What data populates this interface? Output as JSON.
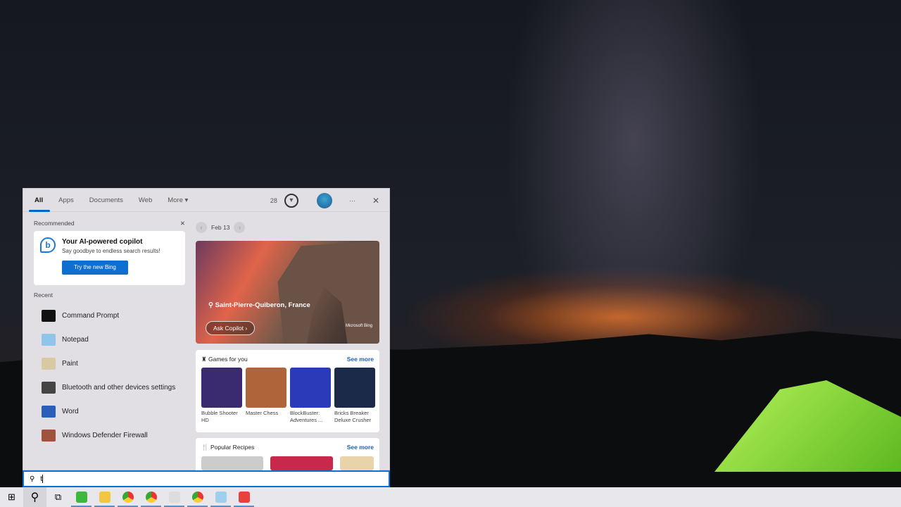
{
  "tabs": [
    "All",
    "Apps",
    "Documents",
    "Web",
    "More ▾"
  ],
  "header": {
    "points": "28",
    "trophy_icon": "trophy-icon",
    "more": "···",
    "close": "✕"
  },
  "recommended": {
    "title": "Recommended",
    "close": "✕",
    "card_title": "Your AI-powered copilot",
    "card_sub": "Say goodbye to endless search results!",
    "button": "Try the new Bing",
    "icon": "b"
  },
  "recent": {
    "title": "Recent",
    "items": [
      {
        "label": "Command Prompt",
        "color": "#111111"
      },
      {
        "label": "Notepad",
        "color": "#8ec5e8"
      },
      {
        "label": "Paint",
        "color": "#d9c9a0"
      },
      {
        "label": "Bluetooth and other devices settings",
        "color": "#444444"
      },
      {
        "label": "Word",
        "color": "#2b5eb8"
      },
      {
        "label": "Windows Defender Firewall",
        "color": "#a0523a"
      }
    ]
  },
  "date": {
    "label": "Feb 13",
    "prev": "‹",
    "next": "›"
  },
  "hero": {
    "location": "Saint-Pierre-Quiberon, France",
    "ask": "Ask Copilot ›",
    "brand": "Microsoft Bing"
  },
  "games": {
    "title": "Games for you",
    "see_more": "See more",
    "items": [
      {
        "name": "Bubble Shooter HD",
        "color": "#3a2a70"
      },
      {
        "name": "Master Chess",
        "color": "#b0643a"
      },
      {
        "name": "BlockBuster: Adventures ...",
        "color": "#2a3ab8"
      },
      {
        "name": "Bricks Breaker Deluxe Crusher",
        "color": "#1a2a48"
      }
    ]
  },
  "recipes": {
    "title": "Popular Recipes",
    "see_more": "See more"
  },
  "search": {
    "value": "t"
  },
  "colors": {
    "accent": "#0f6fd1"
  }
}
